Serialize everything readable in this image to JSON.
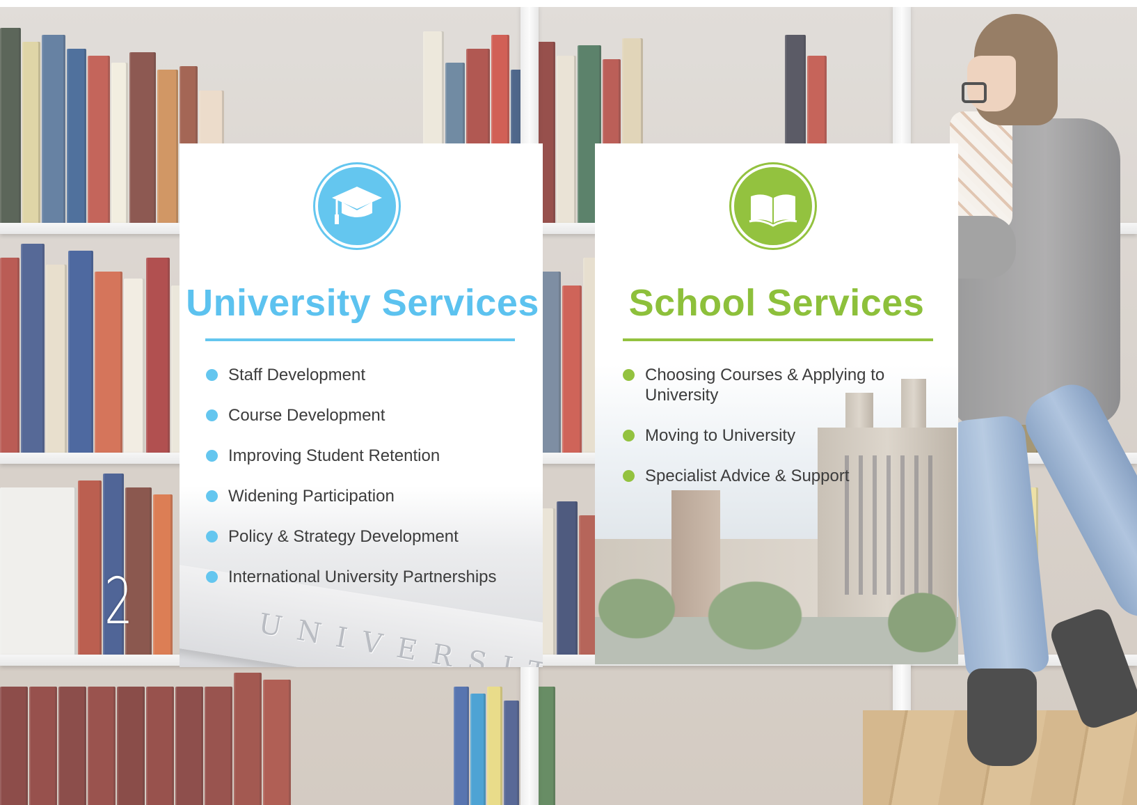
{
  "page_number": "2",
  "colors": {
    "university_accent": "#64c6ef",
    "school_accent": "#93c23f",
    "text": "#3c3c3c"
  },
  "university": {
    "icon": "graduation-cap-icon",
    "title": "University Services",
    "items": [
      "Staff Development",
      "Course Development",
      "Improving Student Retention",
      "Widening Participation",
      "Policy & Strategy Development",
      "International University Partnerships"
    ],
    "image_text": "UNIVERSITY"
  },
  "school": {
    "icon": "open-book-icon",
    "title": "School Services",
    "items": [
      "Choosing Courses & Applying to University",
      "Moving to University",
      "Specialist Advice & Support"
    ]
  }
}
